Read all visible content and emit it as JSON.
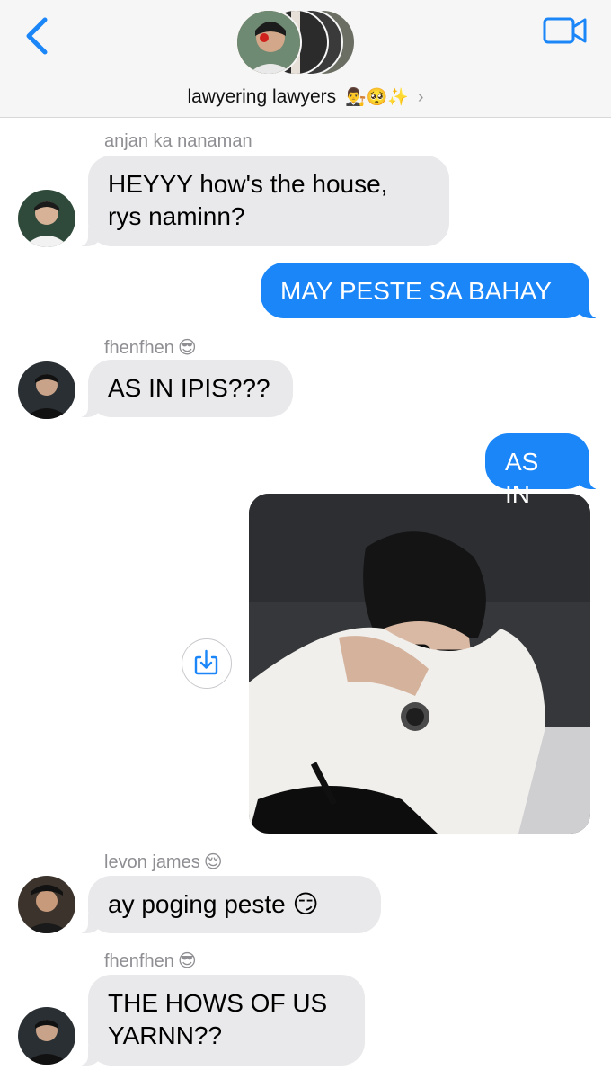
{
  "header": {
    "group_name": "lawyering lawyers",
    "group_emoji": "👨‍⚖️🥺✨",
    "chevron": "›",
    "back_icon": "chevron-left-icon",
    "video_icon": "video-camera-icon",
    "accent": "#1a86f8"
  },
  "messages": [
    {
      "sender": "anjan ka nanaman",
      "sender_emoji": "",
      "text_line1": "HEYYY how's the house,",
      "text_line2": "rys naminn?"
    },
    {
      "outgoing": true,
      "text": "MAY PESTE SA BAHAY"
    },
    {
      "sender": "fhenfhen",
      "sender_emoji": "😎",
      "text": "AS IN IPIS???"
    },
    {
      "outgoing": true,
      "text": "AS IN"
    },
    {
      "outgoing": true,
      "type": "photo",
      "download_icon": "download-icon"
    },
    {
      "sender": "levon james",
      "sender_emoji": "😌",
      "text": "ay poging peste",
      "text_emoji": "😏"
    },
    {
      "sender": "fhenfhen",
      "sender_emoji": "😎",
      "text_line1": "THE HOWS OF US",
      "text_line2": "YARNN??"
    }
  ]
}
